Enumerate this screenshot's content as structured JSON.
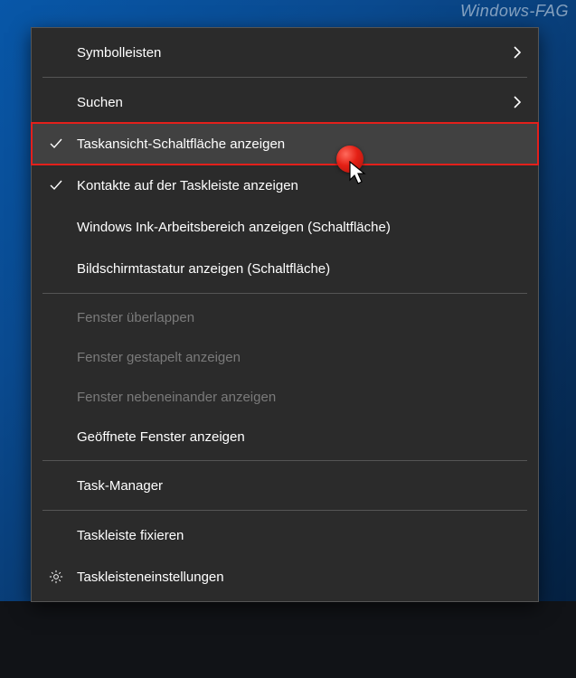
{
  "watermark": "Windows-FAG",
  "menu": {
    "items": [
      {
        "label": "Symbolleisten",
        "hasSubmenu": true
      },
      {
        "label": "Suchen",
        "hasSubmenu": true
      },
      {
        "label": "Taskansicht-Schaltfläche anzeigen",
        "checked": true,
        "highlighted": true
      },
      {
        "label": "Kontakte auf der Taskleiste anzeigen",
        "checked": true
      },
      {
        "label": "Windows Ink-Arbeitsbereich anzeigen (Schaltfläche)"
      },
      {
        "label": "Bildschirmtastatur anzeigen (Schaltfläche)"
      },
      {
        "label": "Fenster überlappen",
        "disabled": true
      },
      {
        "label": "Fenster gestapelt anzeigen",
        "disabled": true
      },
      {
        "label": "Fenster nebeneinander anzeigen",
        "disabled": true
      },
      {
        "label": "Geöffnete Fenster anzeigen"
      },
      {
        "label": "Task-Manager"
      },
      {
        "label": "Taskleiste fixieren"
      },
      {
        "label": "Taskleisteneinstellungen",
        "icon": "gear"
      }
    ]
  }
}
